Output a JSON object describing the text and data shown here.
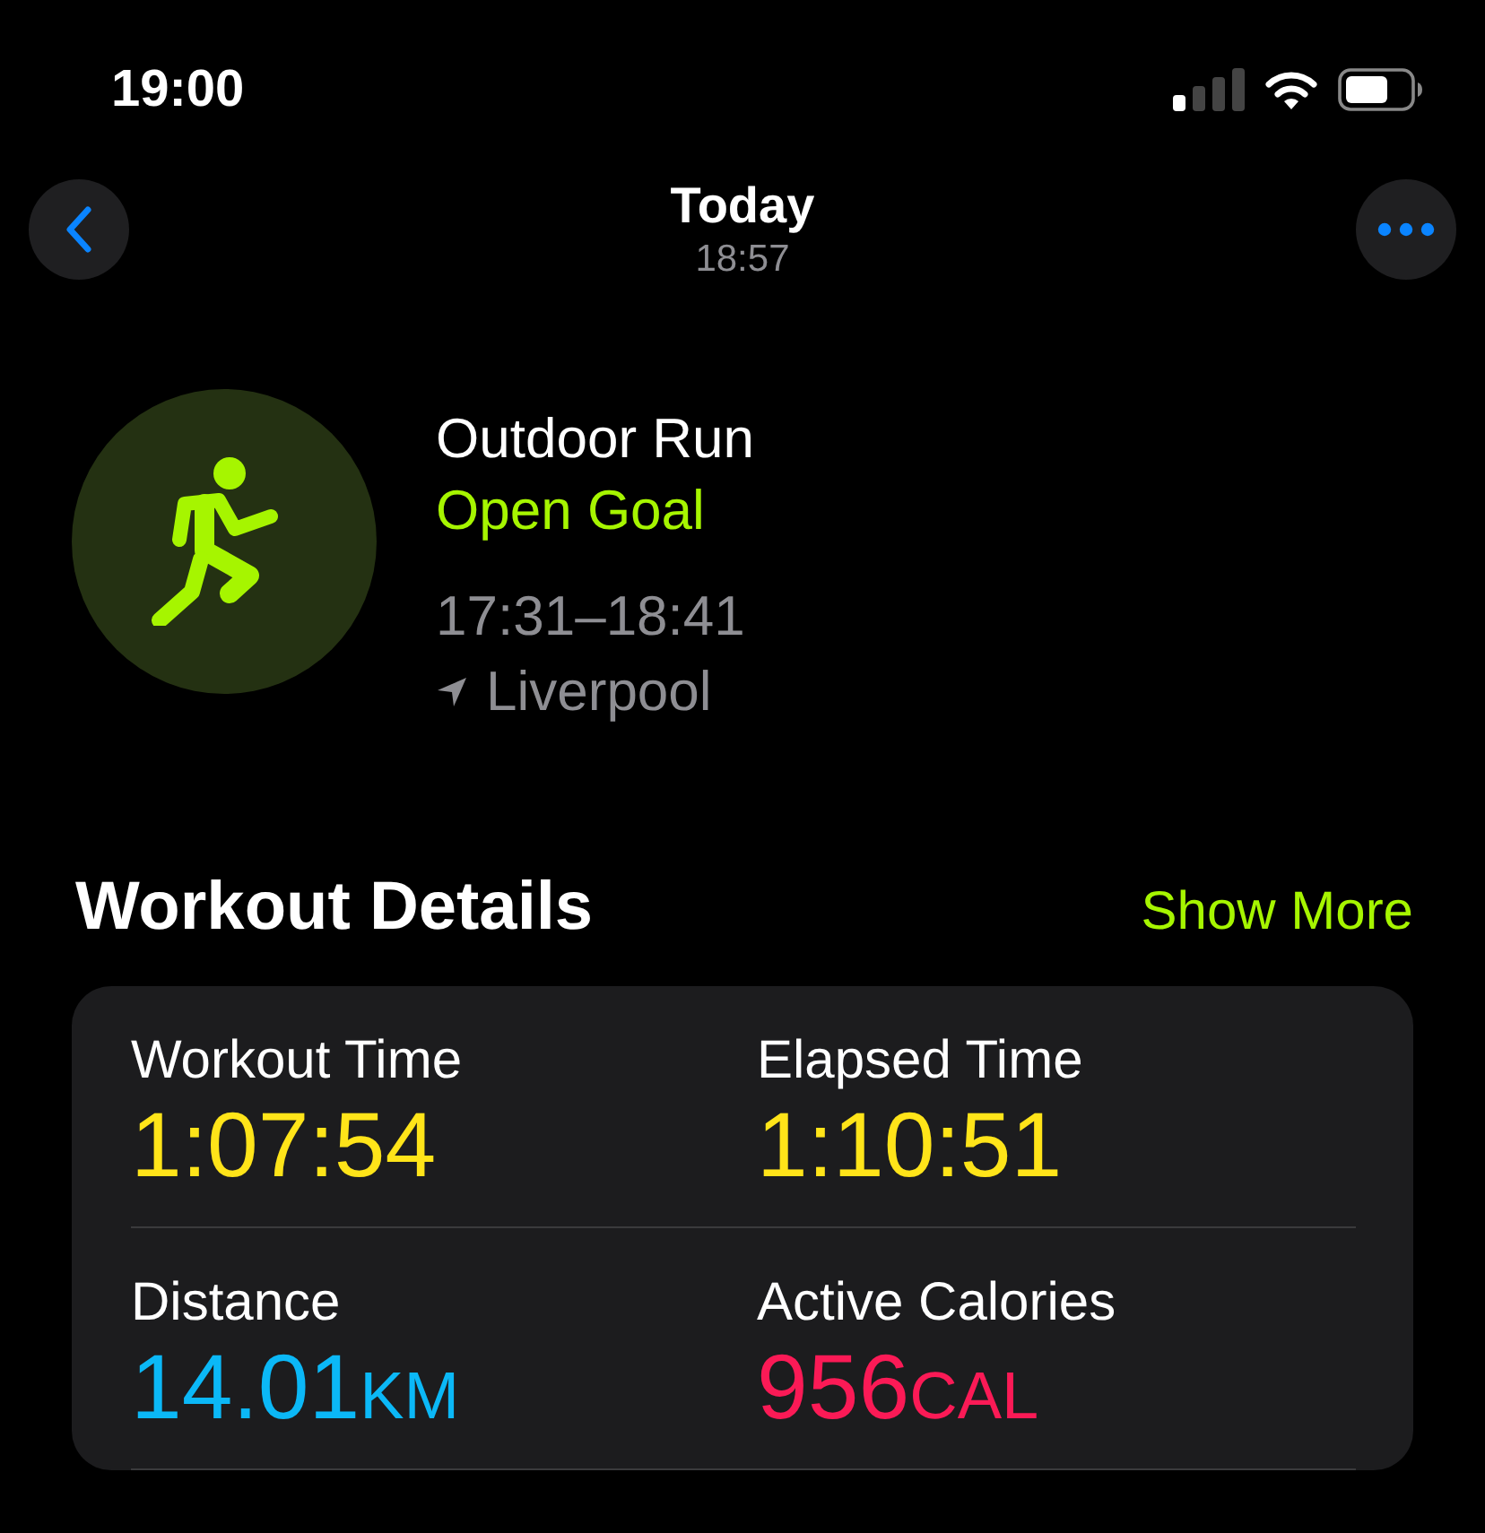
{
  "status_bar": {
    "time": "19:00"
  },
  "nav": {
    "title": "Today",
    "subtitle": "18:57"
  },
  "workout": {
    "name": "Outdoor Run",
    "goal": "Open Goal",
    "time_range": "17:31–18:41",
    "location": "Liverpool"
  },
  "section": {
    "title": "Workout Details",
    "action": "Show More"
  },
  "metrics": [
    {
      "label": "Workout Time",
      "value": "1:07:54",
      "color": "#ffe419"
    },
    {
      "label": "Elapsed Time",
      "value": "1:10:51",
      "color": "#ffe419"
    },
    {
      "label": "Distance",
      "value": "14.01",
      "unit": "KM",
      "color": "#0bb8f7"
    },
    {
      "label": "Active Calories",
      "value": "956",
      "unit": "CAL",
      "color": "#fb1a56"
    }
  ]
}
